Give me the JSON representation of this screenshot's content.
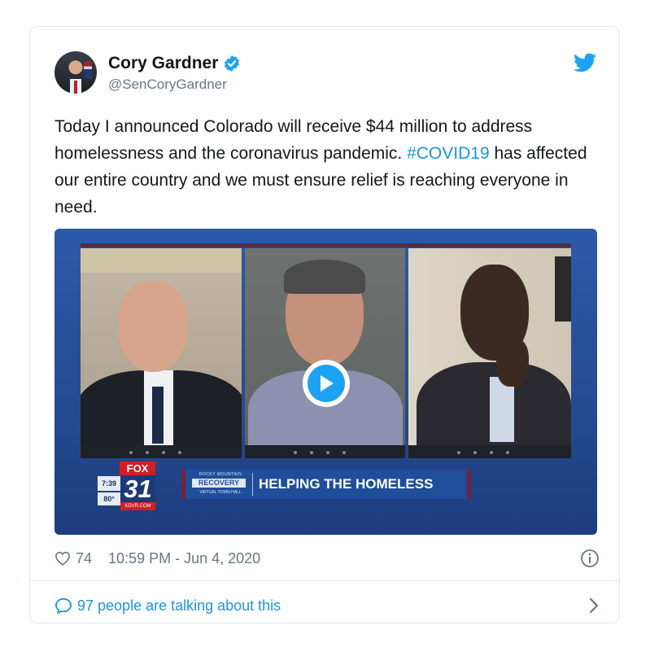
{
  "author": {
    "name": "Cory Gardner",
    "handle": "@SenCoryGardner"
  },
  "tweet": {
    "text_before": "Today I announced Colorado will receive $44 million to address homelessness and the coronavirus pandemic. ",
    "hashtag": "#COVID19",
    "text_after": " has affected our entire country and we must ensure relief is reaching everyone in need."
  },
  "media": {
    "station_logo": "FOX",
    "time": "7:39",
    "temperature": "80°",
    "channel": "31",
    "site": "KDVR.COM",
    "program_top": "ROCKY MOUNTAIN",
    "program_name": "RECOVERY",
    "program_sub": "VIRTUAL TOWN HALL",
    "headline": "HELPING THE HOMELESS"
  },
  "meta": {
    "likes": "74",
    "timestamp": "10:59 PM - Jun 4, 2020"
  },
  "footer": {
    "talking": "97 people are talking about this"
  },
  "colors": {
    "accent": "#1da1f2",
    "link": "#1b95e0",
    "muted": "#657786"
  },
  "icons": [
    "verified-icon",
    "twitter-bird-icon",
    "play-icon",
    "heart-icon",
    "info-icon",
    "comment-bubble-icon",
    "chevron-right-icon"
  ]
}
